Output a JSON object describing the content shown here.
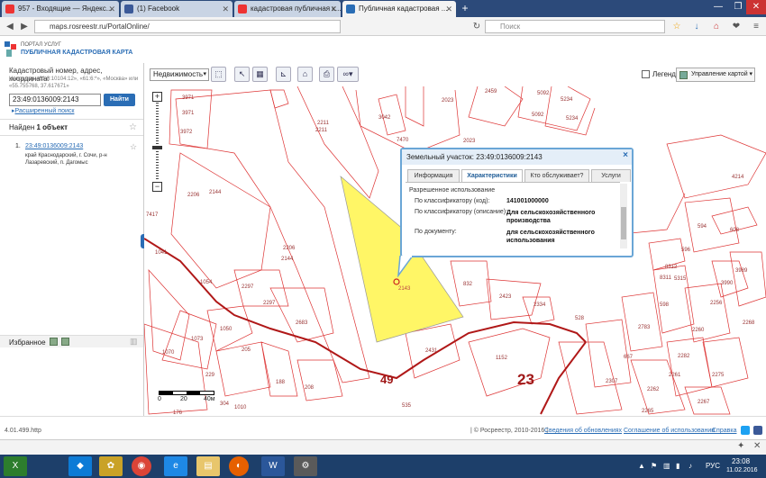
{
  "browser": {
    "tabs": [
      {
        "title": "957 - Входящие — Яндекс..."
      },
      {
        "title": "(1) Facebook"
      },
      {
        "title": "кадастровая публичная к..."
      },
      {
        "title": "Публичная кадастровая ..."
      }
    ],
    "url": "maps.rosreestr.ru/PortalOnline/",
    "search_placeholder": "Поиск"
  },
  "portal": {
    "line1": "ПОРТАЛ УСЛУГ",
    "line2": "ПУБЛИЧНАЯ КАДАСТРОВАЯ КАРТА"
  },
  "sidebar": {
    "search_label": "Кадастровый номер, адрес, координата:",
    "example_text": "Например «61:8:10104:12», «61:6:*», «Москва» или «55.755768, 37.617671»",
    "search_value": "23:49:0136009:2143",
    "search_button": "Найти",
    "advanced_search": "Расширенный поиск",
    "found_prefix": "Найден ",
    "found_count": "1 объект",
    "result_index": "1.",
    "result_link": "23:49:0136009:2143",
    "result_address": "край Краснодарский, г. Сочи, р-н Лазаревский, п. Дагомыс",
    "favorites_label": "Избранное"
  },
  "toolbar": {
    "layer_select": "Недвижимость",
    "legend_label": "Легенда",
    "map_control": "Управление картой"
  },
  "popup": {
    "title": "Земельный участок: 23:49:0136009:2143",
    "tabs": [
      "Информация",
      "Характеристики",
      "Кто обслуживает?",
      "Услуги"
    ],
    "section": "Разрешенное использование",
    "rows": [
      {
        "label": "По классификатору (код):",
        "value": "141001000000"
      },
      {
        "label": "По классификатору (описание):",
        "value": "Для сельскохозяйственного производства"
      },
      {
        "label": "По документу:",
        "value": "для сельскохозяйственного использования"
      }
    ],
    "close": "×"
  },
  "map": {
    "scale_labels": [
      "0",
      "20",
      "40м"
    ],
    "parcel_labels": [
      "3971",
      "3971",
      "3972",
      "2211",
      "2211",
      "3042",
      "2023",
      "2459",
      "5092",
      "5092",
      "5234",
      "5234",
      "7470",
      "2023",
      "4214",
      "2206",
      "2144",
      "2206",
      "2144",
      "1041",
      "1054",
      "2297",
      "2297",
      "2683",
      "832",
      "2423",
      "2334",
      "528",
      "594",
      "608",
      "596",
      "8312",
      "8311",
      "5315",
      "3989",
      "3990",
      "2256",
      "598",
      "2268",
      "2783",
      "2260",
      "1073",
      "1050",
      "1070",
      "2431",
      "1152",
      "667",
      "2282",
      "2275",
      "229",
      "205",
      "188",
      "208",
      "2307",
      "2261",
      "2262",
      "2267",
      "2265",
      "176",
      "304",
      "535",
      "1010",
      "3345",
      "7417"
    ],
    "selected_label": "2143",
    "district_labels": [
      "49",
      "23"
    ],
    "accent_yellow": "#fff666",
    "line_red": "#cc2222"
  },
  "footer": {
    "version": "4.01.499.http",
    "copyright": "| © Росреестр, 2010-2016 |",
    "link_updates": "Сведения об обновлениях",
    "link_agreement": "Соглашение об использовании",
    "link_help": "Справка"
  },
  "taskbar": {
    "lang": "РУС",
    "time": "23:08",
    "date": "11.02.2016"
  }
}
